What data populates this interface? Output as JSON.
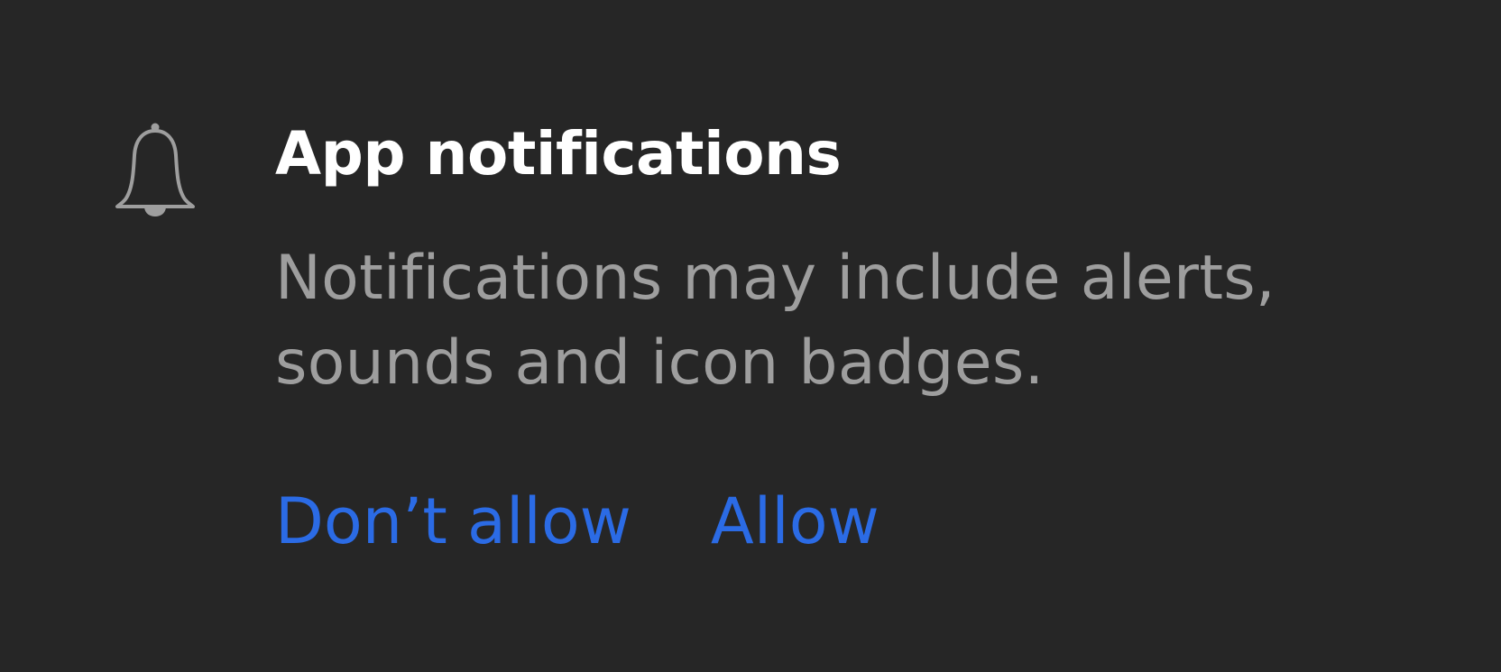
{
  "dialog": {
    "icon": "bell-icon",
    "title": "App notifications",
    "message": "Notifications may include alerts, sounds and icon badges.",
    "actions": {
      "deny_label": "Don’t allow",
      "allow_label": "Allow"
    }
  },
  "colors": {
    "background": "#262626",
    "title": "#ffffff",
    "message": "#9e9e9e",
    "icon": "#9e9e9e",
    "action": "#2b6be5"
  }
}
